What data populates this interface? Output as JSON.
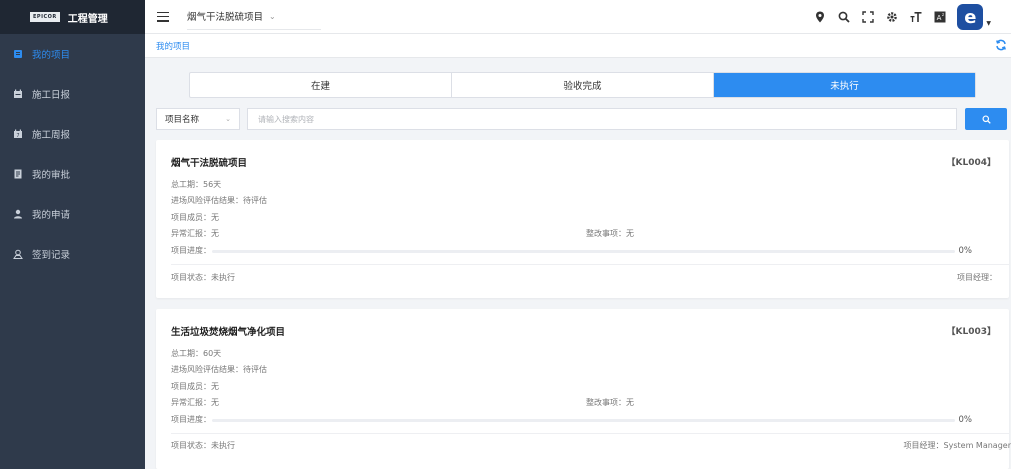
{
  "sidebar": {
    "logo_text": "EPICOR",
    "title": "工程管理",
    "items": [
      {
        "label": "我的项目",
        "icon": "project-icon",
        "active": true
      },
      {
        "label": "施工日报",
        "icon": "daily-report-icon",
        "active": false
      },
      {
        "label": "施工周报",
        "icon": "weekly-report-icon",
        "active": false
      },
      {
        "label": "我的审批",
        "icon": "approval-icon",
        "active": false
      },
      {
        "label": "我的申请",
        "icon": "user-icon",
        "active": false
      },
      {
        "label": "签到记录",
        "icon": "checkin-icon",
        "active": false
      }
    ]
  },
  "header": {
    "current_project": "烟气干法脱硫项目",
    "avatar_letter": "e",
    "tools": [
      "location-icon",
      "search-icon",
      "fullscreen-icon",
      "settings-icon",
      "font-size-icon",
      "translate-icon"
    ]
  },
  "breadcrumb": "我的项目",
  "tabs": [
    {
      "label": "在建",
      "active": false
    },
    {
      "label": "验收完成",
      "active": false
    },
    {
      "label": "未执行",
      "active": true
    }
  ],
  "filter": {
    "field_label": "项目名称",
    "search_placeholder": "请输入搜索内容"
  },
  "labels": {
    "duration": "总工期：",
    "risk": "进场风险评估结果：",
    "members": "项目成员：",
    "anomaly": "异常汇报：",
    "rectification": "整改事项：",
    "progress": "项目进度：",
    "status": "项目状态：",
    "manager": "项目经理："
  },
  "projects": [
    {
      "name": "烟气干法脱硫项目",
      "code": "【KL004】",
      "duration": "56天",
      "risk": "待评估",
      "members": "无",
      "anomaly": "无",
      "rectification": "无",
      "progress": 0,
      "progress_text": "0%",
      "status": "未执行",
      "manager": ""
    },
    {
      "name": "生活垃圾焚烧烟气净化项目",
      "code": "【KL003】",
      "duration": "60天",
      "risk": "待评估",
      "members": "无",
      "anomaly": "无",
      "rectification": "无",
      "progress": 0,
      "progress_text": "0%",
      "status": "未执行",
      "manager": "System Manager"
    }
  ],
  "colors": {
    "accent": "#2d8cf0",
    "sidebar_bg": "#2f3a4b",
    "sidebar_brand_bg": "#1f2733",
    "avatar_bg": "#1e4fa1"
  }
}
